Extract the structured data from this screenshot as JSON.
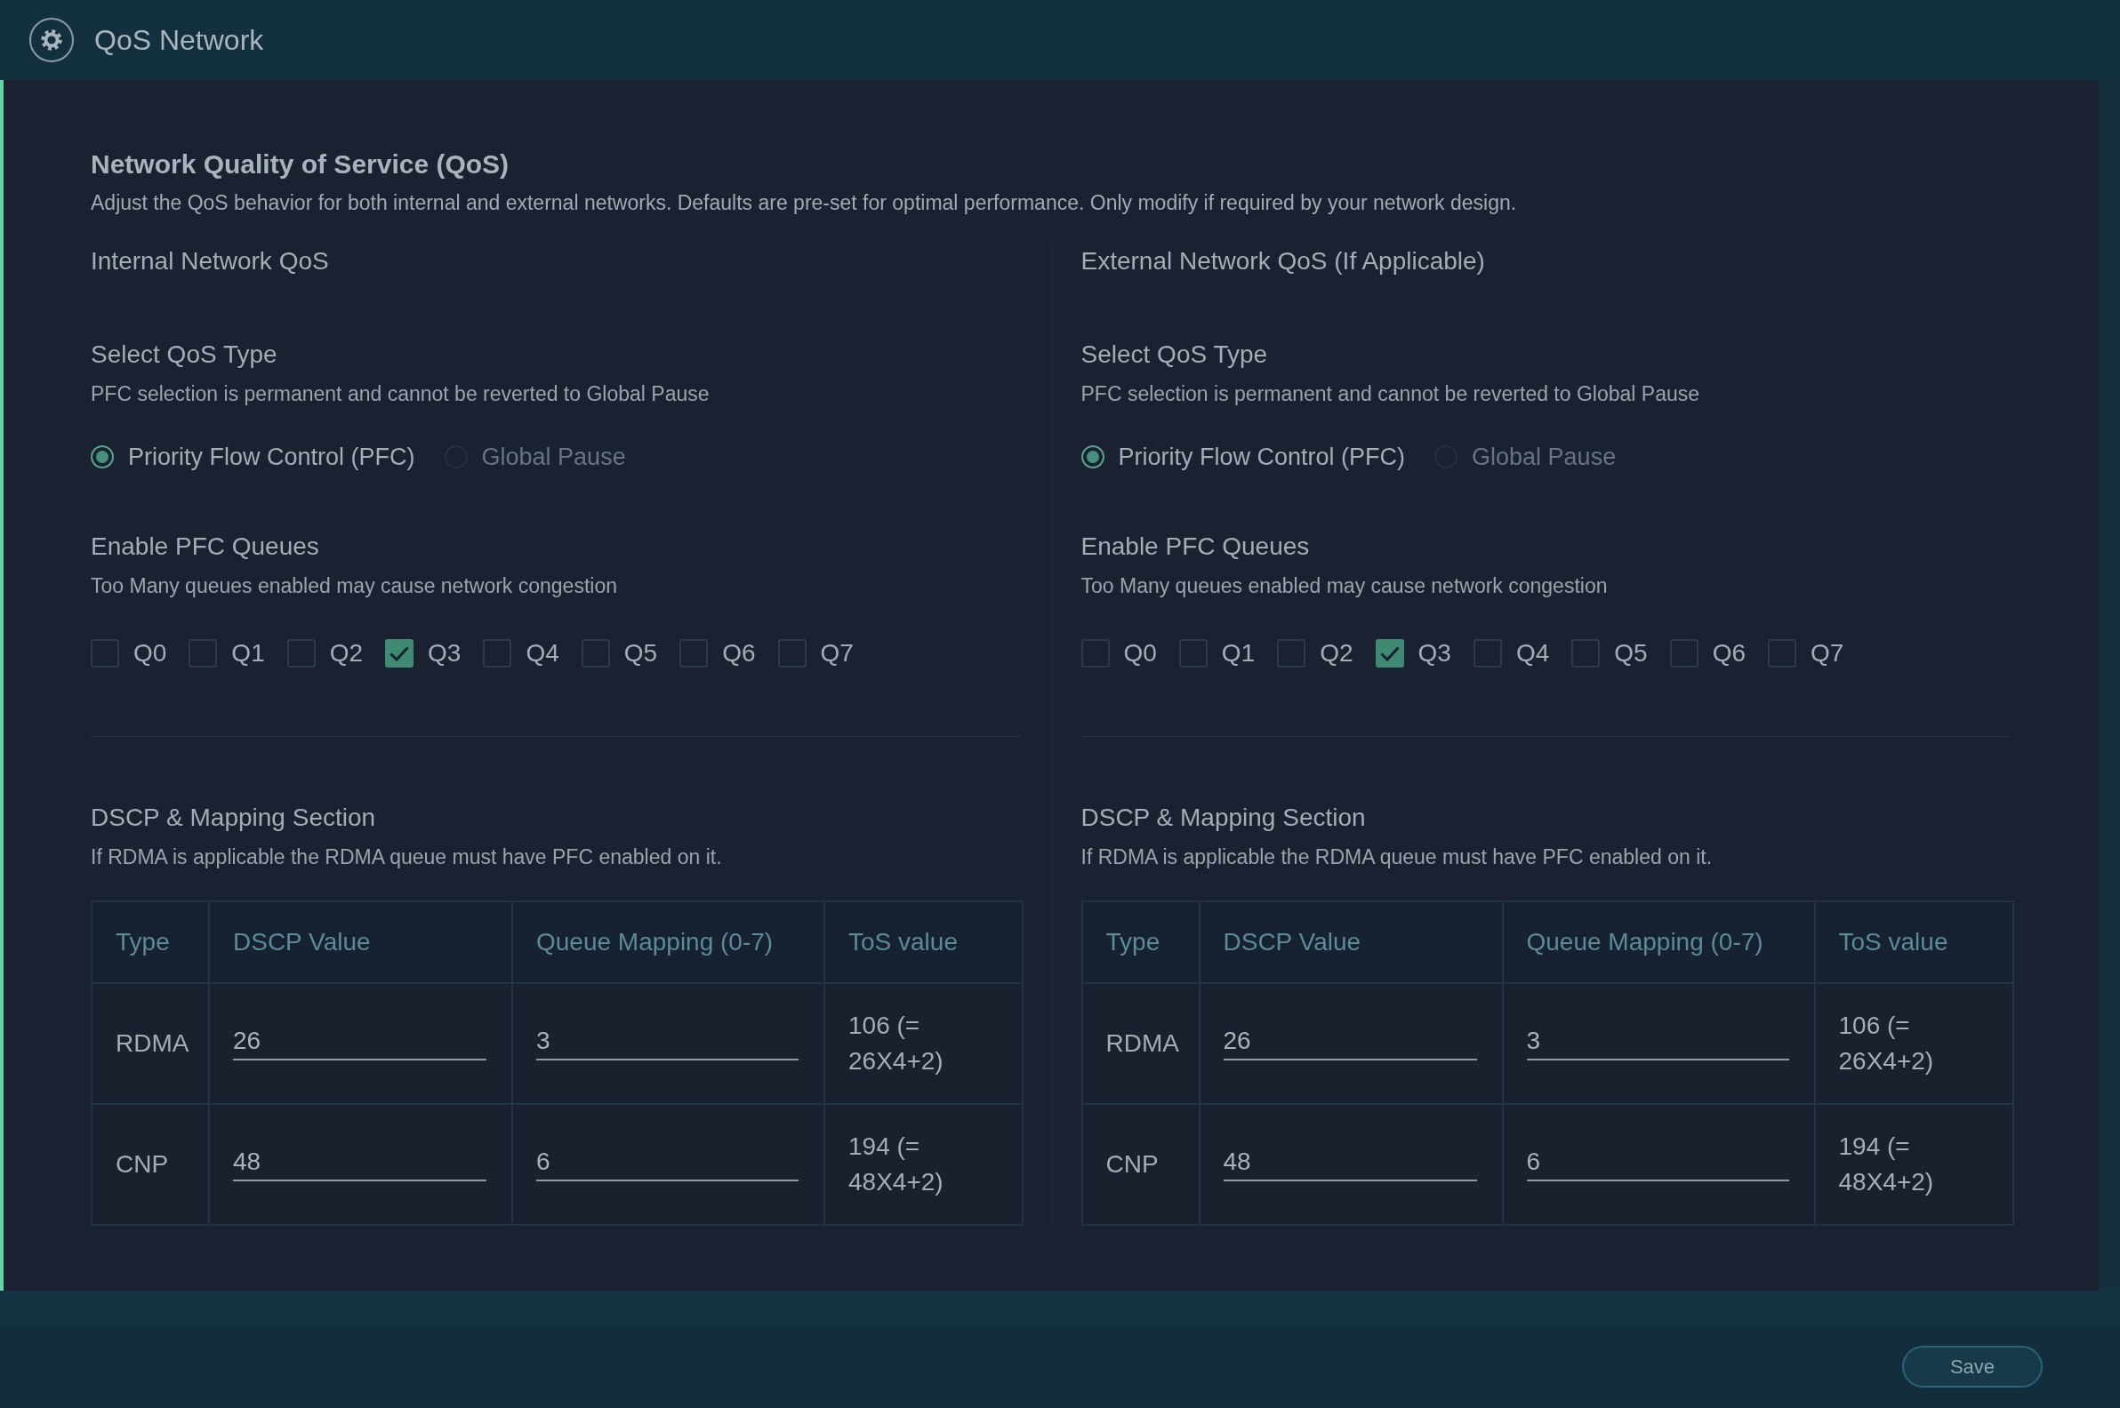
{
  "header": {
    "title": "QoS Network"
  },
  "page": {
    "title": "Network Quality of Service (QoS)",
    "description": "Adjust the QoS behavior for both internal and external networks. Defaults are pre-set for optimal performance. Only modify if required by your network design."
  },
  "sections": [
    {
      "title": "Internal Network QoS",
      "qos_type": {
        "label": "Select QoS Type",
        "hint": "PFC selection is permanent and cannot be reverted to Global Pause",
        "options": [
          {
            "label": "Priority Flow Control (PFC)",
            "selected": true,
            "disabled": false
          },
          {
            "label": "Global Pause",
            "selected": false,
            "disabled": true
          }
        ]
      },
      "pfc_queues": {
        "label": "Enable PFC Queues",
        "hint": "Too Many queues enabled may cause network congestion",
        "queues": [
          {
            "label": "Q0",
            "checked": false
          },
          {
            "label": "Q1",
            "checked": false
          },
          {
            "label": "Q2",
            "checked": false
          },
          {
            "label": "Q3",
            "checked": true
          },
          {
            "label": "Q4",
            "checked": false
          },
          {
            "label": "Q5",
            "checked": false
          },
          {
            "label": "Q6",
            "checked": false
          },
          {
            "label": "Q7",
            "checked": false
          }
        ]
      },
      "dscp_mapping": {
        "label": "DSCP & Mapping Section",
        "hint": "If RDMA is applicable the RDMA queue must have PFC enabled on it.",
        "table": {
          "columns": [
            "Type",
            "DSCP Value",
            "Queue Mapping (0-7)",
            "ToS value"
          ],
          "rows": [
            {
              "cells": [
                {
                  "kind": "text",
                  "value": "RDMA"
                },
                {
                  "kind": "input",
                  "value": "26"
                },
                {
                  "kind": "input",
                  "value": "3"
                },
                {
                  "kind": "text",
                  "value": "106 (= 26X4+2)"
                }
              ]
            },
            {
              "cells": [
                {
                  "kind": "text",
                  "value": "CNP"
                },
                {
                  "kind": "input",
                  "value": "48"
                },
                {
                  "kind": "input",
                  "value": "6"
                },
                {
                  "kind": "text",
                  "value": "194 (= 48X4+2)"
                }
              ]
            }
          ]
        }
      }
    },
    {
      "title": "External Network QoS (If Applicable)",
      "qos_type": {
        "label": "Select QoS Type",
        "hint": "PFC selection is permanent and cannot be reverted to Global Pause",
        "options": [
          {
            "label": "Priority Flow Control (PFC)",
            "selected": true,
            "disabled": false
          },
          {
            "label": "Global Pause",
            "selected": false,
            "disabled": true
          }
        ]
      },
      "pfc_queues": {
        "label": "Enable PFC Queues",
        "hint": "Too Many queues enabled may cause network congestion",
        "queues": [
          {
            "label": "Q0",
            "checked": false
          },
          {
            "label": "Q1",
            "checked": false
          },
          {
            "label": "Q2",
            "checked": false
          },
          {
            "label": "Q3",
            "checked": true
          },
          {
            "label": "Q4",
            "checked": false
          },
          {
            "label": "Q5",
            "checked": false
          },
          {
            "label": "Q6",
            "checked": false
          },
          {
            "label": "Q7",
            "checked": false
          }
        ]
      },
      "dscp_mapping": {
        "label": "DSCP & Mapping Section",
        "hint": "If RDMA is applicable the RDMA queue must have PFC enabled on it.",
        "table": {
          "columns": [
            "Type",
            "DSCP Value",
            "Queue Mapping (0-7)",
            "ToS value"
          ],
          "rows": [
            {
              "cells": [
                {
                  "kind": "text",
                  "value": "RDMA"
                },
                {
                  "kind": "input",
                  "value": "26"
                },
                {
                  "kind": "input",
                  "value": "3"
                },
                {
                  "kind": "text",
                  "value": "106 (= 26X4+2)"
                }
              ]
            },
            {
              "cells": [
                {
                  "kind": "text",
                  "value": "CNP"
                },
                {
                  "kind": "input",
                  "value": "48"
                },
                {
                  "kind": "input",
                  "value": "6"
                },
                {
                  "kind": "text",
                  "value": "194 (= 48X4+2)"
                }
              ]
            }
          ]
        }
      }
    }
  ],
  "buttons": [
    {
      "label": "Save"
    }
  ]
}
